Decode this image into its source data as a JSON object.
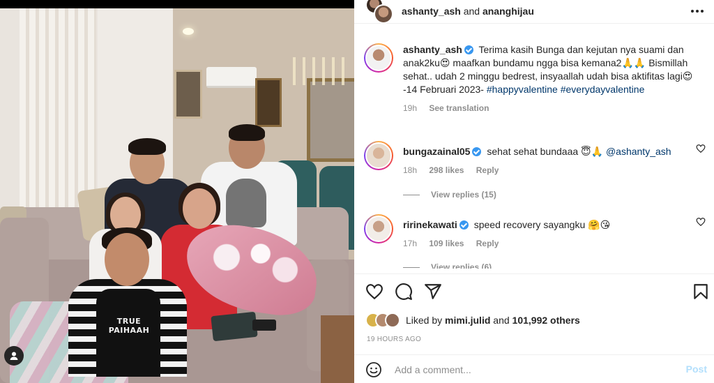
{
  "post": {
    "header": {
      "author": "ashanty_ash",
      "connector": "and",
      "collaborator": "ananghijau"
    },
    "caption": {
      "username": "ashanty_ash",
      "text": "Terima kasih Bunga dan kejutan nya suami dan anak2ku😍 maafkan bundamu ngga bisa kemana2🙏🙏 Bismillah sehat.. udah 2 minggu bedrest, insyaallah udah bisa aktifitas lagi😍 -14 Februari 2023-",
      "hashtags": [
        "#happyvalentine",
        "#everydayvalentine"
      ],
      "age": "19h",
      "see_translation": "See translation"
    },
    "comments": [
      {
        "username": "bungazainal05",
        "text": "sehat sehat bundaaa 😇🙏",
        "mention": "@ashanty_ash",
        "age": "18h",
        "likes": "298 likes",
        "reply": "Reply",
        "view_replies": "View replies (15)"
      },
      {
        "username": "ririnekawati",
        "text": "speed recovery sayangku 🤗😘",
        "mention": "",
        "age": "17h",
        "likes": "109 likes",
        "reply": "Reply",
        "view_replies": "View replies (6)"
      }
    ],
    "likes": {
      "prefix": "Liked by",
      "liker": "mimi.julid",
      "connector": "and",
      "others": "101,992 others"
    },
    "timestamp": "19 HOURS AGO",
    "add_comment": {
      "placeholder": "Add a comment...",
      "post_label": "Post"
    },
    "photo": {
      "shirt_text": "TRUE PAIHAAH"
    }
  },
  "icons": {
    "header_more": "more-horizontal-icon",
    "like": "heart-icon",
    "comment": "comment-icon",
    "share": "paper-plane-icon",
    "save": "bookmark-icon",
    "emoji": "emoji-icon",
    "user_tags": "user-icon"
  },
  "colors": {
    "verified": "#3897f0",
    "hashtag": "#00376b",
    "muted": "#8e8e8e",
    "post_disabled": "#b2dffc"
  }
}
